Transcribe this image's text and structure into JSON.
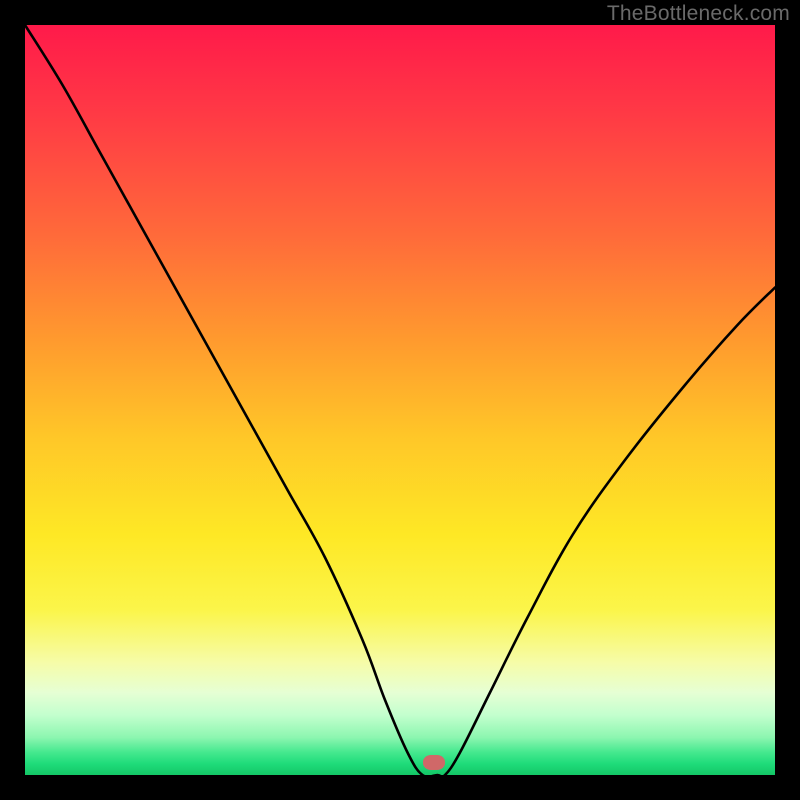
{
  "watermark": "TheBottleneck.com",
  "marker": {
    "color": "#d06868",
    "x_pct": 54.5,
    "y_pct": 98.2
  },
  "chart_data": {
    "type": "line",
    "title": "",
    "xlabel": "",
    "ylabel": "",
    "xlim": [
      0,
      100
    ],
    "ylim": [
      0,
      100
    ],
    "grid": false,
    "legend": false,
    "background": "sunset-gradient",
    "series": [
      {
        "name": "bottleneck-curve",
        "x": [
          0,
          5,
          10,
          15,
          20,
          25,
          30,
          35,
          40,
          45,
          48,
          51,
          53,
          55,
          56,
          58,
          62,
          67,
          73,
          80,
          88,
          95,
          100
        ],
        "values": [
          100,
          92,
          83,
          74,
          65,
          56,
          47,
          38,
          29,
          18,
          10,
          3,
          0,
          0,
          0,
          3,
          11,
          21,
          32,
          42,
          52,
          60,
          65
        ]
      }
    ],
    "marker_point": {
      "x": 54.5,
      "y": 0
    },
    "gradient_stops": [
      {
        "pct": 0,
        "color": "#ff1a4a"
      },
      {
        "pct": 12,
        "color": "#ff3a45"
      },
      {
        "pct": 28,
        "color": "#ff6a3a"
      },
      {
        "pct": 42,
        "color": "#ff9a2e"
      },
      {
        "pct": 55,
        "color": "#ffc728"
      },
      {
        "pct": 68,
        "color": "#fee825"
      },
      {
        "pct": 78,
        "color": "#fbf54a"
      },
      {
        "pct": 85,
        "color": "#f6fca8"
      },
      {
        "pct": 89,
        "color": "#e6ffd4"
      },
      {
        "pct": 92,
        "color": "#c3ffce"
      },
      {
        "pct": 95,
        "color": "#8cf6b0"
      },
      {
        "pct": 97,
        "color": "#44e88e"
      },
      {
        "pct": 98.5,
        "color": "#1fdc7a"
      },
      {
        "pct": 100,
        "color": "#14c666"
      }
    ]
  }
}
